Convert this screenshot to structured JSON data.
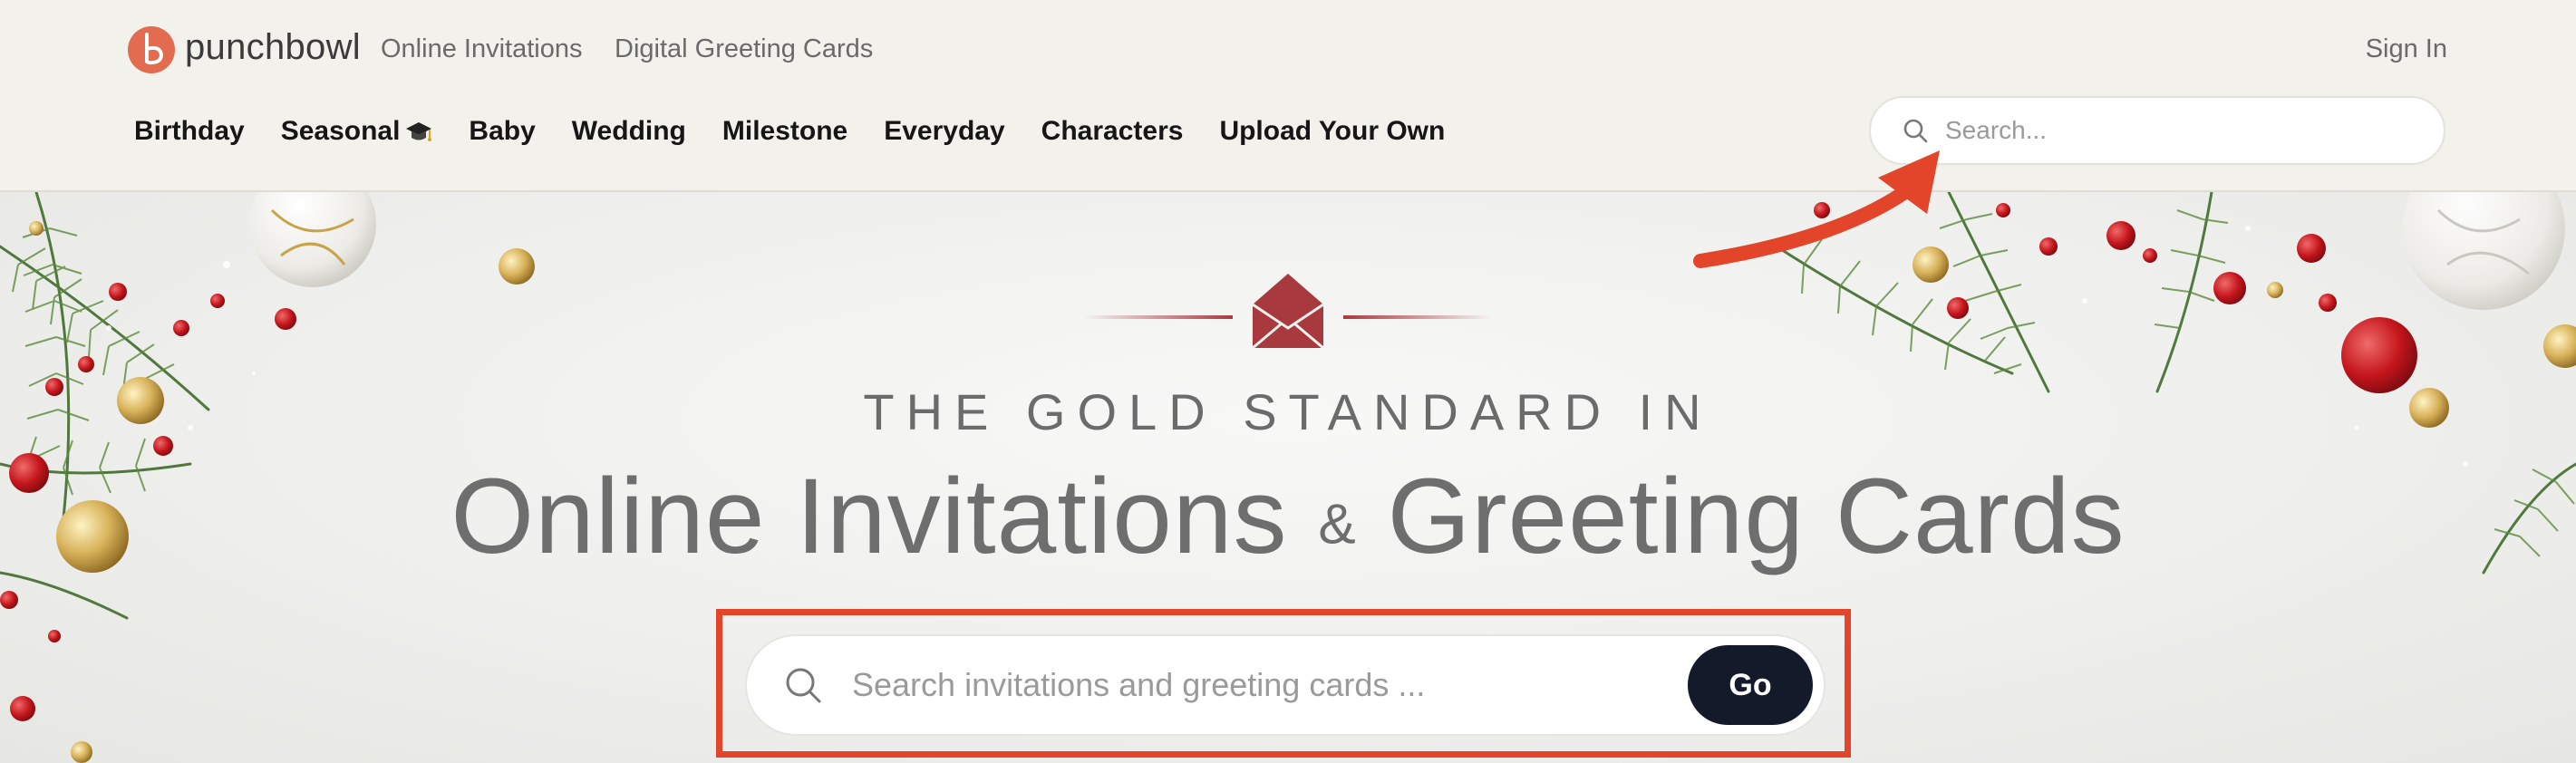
{
  "brand": {
    "name": "punchbowl"
  },
  "top_links": {
    "invitations": "Online Invitations",
    "cards": "Digital Greeting Cards"
  },
  "account": {
    "sign_in": "Sign In"
  },
  "nav": {
    "items": [
      {
        "label": "Birthday"
      },
      {
        "label": "Seasonal",
        "icon": "graduation-cap-icon"
      },
      {
        "label": "Baby"
      },
      {
        "label": "Wedding"
      },
      {
        "label": "Milestone"
      },
      {
        "label": "Everyday"
      },
      {
        "label": "Characters"
      },
      {
        "label": "Upload Your Own"
      }
    ]
  },
  "header_search": {
    "placeholder": "Search..."
  },
  "hero": {
    "kicker": "THE GOLD STANDARD IN",
    "headline_part1": "Online Invitations ",
    "headline_amp": "&",
    "headline_part2": " Greeting Cards",
    "search_placeholder": "Search invitations and greeting cards ...",
    "go_label": "Go"
  },
  "colors": {
    "header_bg": "#f2f1ec",
    "brand_coral": "#e36b50",
    "envelope_red": "#a83a3f",
    "annotation_red": "#e3452a",
    "go_button": "#141a2a"
  }
}
